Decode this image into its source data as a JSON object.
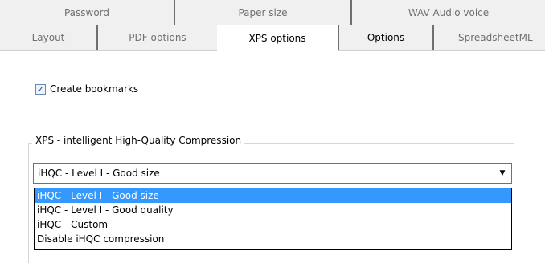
{
  "tabs_row1": [
    "Password",
    "Paper size",
    "WAV Audio voice"
  ],
  "tabs_row2": [
    "Layout",
    "PDF options",
    "XPS options",
    "Options",
    "SpreadsheetML"
  ],
  "active_tab": "XPS options",
  "bookmarks": {
    "label": "Create bookmarks",
    "checked": true
  },
  "compression": {
    "group_label": "XPS - intelligent High-Quality Compression",
    "selected": "iHQC - Level I - Good size",
    "options": [
      "iHQC - Level I - Good size",
      "iHQC - Level I - Good quality",
      "iHQC - Custom",
      "Disable iHQC compression"
    ]
  },
  "colors": {
    "selection": "#3399ff",
    "tab_bg": "#f0f0f0"
  }
}
